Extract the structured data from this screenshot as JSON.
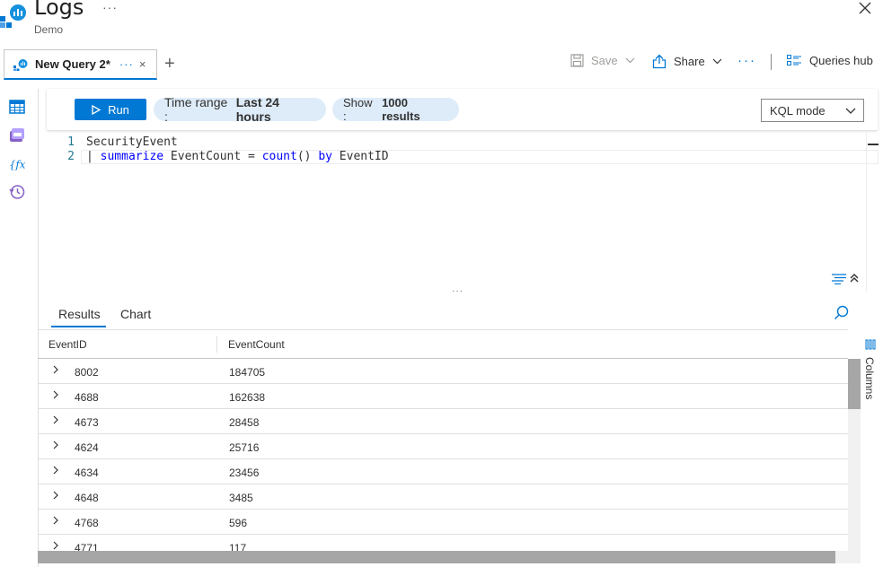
{
  "header": {
    "title": "Logs",
    "title_more": "···",
    "subtitle": "Demo"
  },
  "tabs": [
    {
      "label": "New Query 2*",
      "more": "···",
      "close": "×"
    }
  ],
  "add_tab": "+",
  "toolbar": {
    "save_label": "Save",
    "share_label": "Share",
    "more": "···",
    "queries_hub_label": "Queries hub"
  },
  "query_bar": {
    "run_label": "Run",
    "time_range_prefix": "Time range :",
    "time_range_value": "Last 24 hours",
    "show_prefix": "Show :",
    "show_value": "1000 results",
    "mode_value": "KQL mode"
  },
  "editor": {
    "line_numbers": [
      "1",
      "2"
    ],
    "line1": "SecurityEvent",
    "line2_pipe": "| ",
    "line2_kw1": "summarize",
    "line2_mid": " EventCount = ",
    "line2_kw2": "count",
    "line2_paren": "() ",
    "line2_kw3": "by",
    "line2_end": " EventID"
  },
  "results": {
    "tabs": [
      "Results",
      "Chart"
    ],
    "columns": [
      "EventID",
      "EventCount"
    ],
    "rows": [
      {
        "event_id": "8002",
        "event_count": "184705"
      },
      {
        "event_id": "4688",
        "event_count": "162638"
      },
      {
        "event_id": "4673",
        "event_count": "28458"
      },
      {
        "event_id": "4624",
        "event_count": "25716"
      },
      {
        "event_id": "4634",
        "event_count": "23456"
      },
      {
        "event_id": "4648",
        "event_count": "3485"
      },
      {
        "event_id": "4768",
        "event_count": "596"
      },
      {
        "event_id": "4771",
        "event_count": "117"
      }
    ],
    "columns_panel_label": "Columns"
  },
  "colors": {
    "accent": "#0078d4",
    "pill_bg": "#deecf9",
    "keyword": "#0000ff"
  }
}
